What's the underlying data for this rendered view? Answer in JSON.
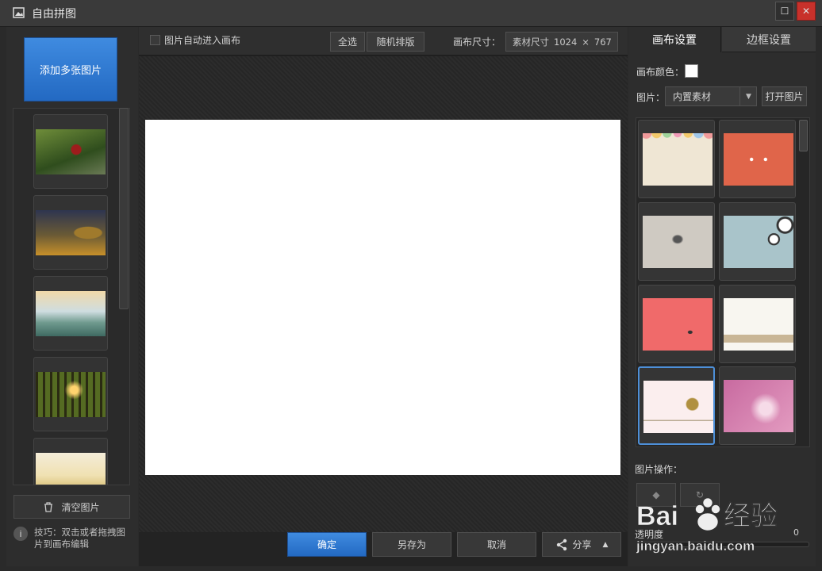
{
  "window": {
    "title": "自由拼图",
    "maximize_icon": "☐",
    "close_icon": "✕"
  },
  "left": {
    "add_button": "添加多张图片",
    "thumbnails": [
      {
        "name": "red-flower-photo"
      },
      {
        "name": "robot-toy-photo"
      },
      {
        "name": "landscape-painting"
      },
      {
        "name": "forest-sunset-photo"
      },
      {
        "name": "field-photo"
      }
    ],
    "clear_button": "清空图片",
    "tip_icon": "i",
    "tip_text": "技巧：双击或者拖拽图片到画布编辑"
  },
  "toolbar": {
    "auto_enter_label": "图片自动进入画布",
    "auto_enter_checked": false,
    "select_all": "全选",
    "random_layout": "随机排版",
    "canvas_size_label": "画布尺寸：",
    "canvas_size_value": "素材尺寸",
    "canvas_width": "1024",
    "times": "×",
    "canvas_height": "767"
  },
  "canvas": {
    "background": "#ffffff"
  },
  "bottom": {
    "ok": "确定",
    "save_as": "另存为",
    "cancel": "取消",
    "share": "分享",
    "share_arrow": "▲"
  },
  "right": {
    "tabs": [
      {
        "label": "画布设置",
        "active": true
      },
      {
        "label": "边框设置",
        "active": false
      }
    ],
    "canvas_color_label": "画布颜色：",
    "canvas_color": "#ffffff",
    "image_label": "图片：",
    "image_source": "内置素材",
    "dropdown_arrow": "▼",
    "open_image": "打开图片",
    "materials": [
      {
        "name": "polka-dot-bunting",
        "selected": false
      },
      {
        "name": "orange-icons",
        "selected": false
      },
      {
        "name": "gray-sketch",
        "selected": false
      },
      {
        "name": "blue-dandelion",
        "selected": false
      },
      {
        "name": "coral-figure",
        "selected": false
      },
      {
        "name": "white-landscape",
        "selected": false
      },
      {
        "name": "pink-tree",
        "selected": true
      },
      {
        "name": "purple-bokeh",
        "selected": false
      }
    ],
    "ops_label": "图片操作：",
    "opacity_label": "透明度",
    "opacity_value": "0"
  },
  "watermark": {
    "brand": "Baidu经验",
    "url": "jingyan.baidu.com"
  }
}
